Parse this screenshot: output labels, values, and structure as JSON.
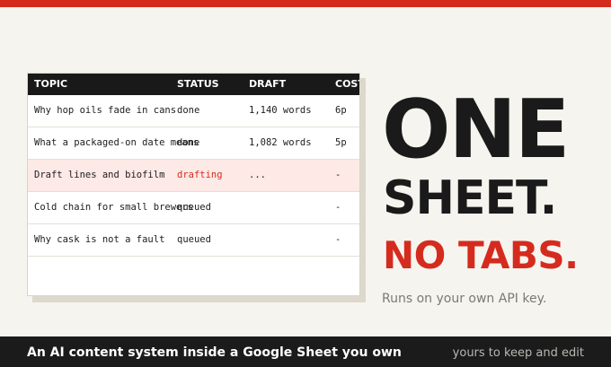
{
  "sheet": {
    "columns": [
      "TOPIC",
      "STATUS",
      "DRAFT",
      "COST"
    ],
    "rows": [
      {
        "topic": "Why hop oils fade in cans",
        "status": "done",
        "draft": "1,140 words",
        "cost": "6p"
      },
      {
        "topic": "What a packaged-on date means",
        "status": "done",
        "draft": "1,082 words",
        "cost": "5p"
      },
      {
        "topic": "Draft lines and biofilm",
        "status": "drafting",
        "draft": "...",
        "cost": "-"
      },
      {
        "topic": "Cold chain for small brewers",
        "status": "queued",
        "draft": "",
        "cost": "-"
      },
      {
        "topic": "Why cask is not a fault",
        "status": "queued",
        "draft": "",
        "cost": "-"
      }
    ]
  },
  "headline": {
    "line1": "ONE",
    "line2": "SHEET.",
    "line3": "NO TABS.",
    "subtitle": "Runs on your own API key."
  },
  "footer": {
    "tagline": "An AI content system inside a Google Sheet you own",
    "right": "yours to keep and edit"
  },
  "colors": {
    "accent": "#d52b1e",
    "dark": "#1b1b1b",
    "background": "#f5f4ef",
    "active_row": "#fde9e6"
  }
}
